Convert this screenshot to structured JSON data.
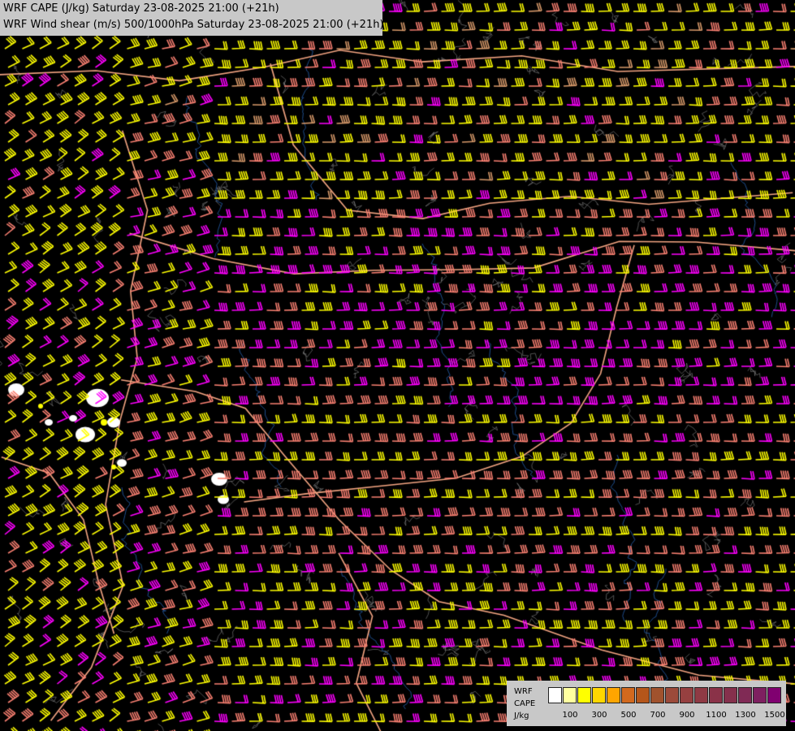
{
  "titles": {
    "line1": "WRF CAPE (J/kg) Saturday 23-08-2025 21:00 (+21h)",
    "line2": "WRF Wind shear (m/s) 500/1000hPa Saturday 23-08-2025 21:00 (+21h)"
  },
  "legend": {
    "label_line1": "WRF",
    "label_line2": "CAPE",
    "label_line3": "J/kg",
    "colors": [
      "#ffffff",
      "#ffffa0",
      "#ffff00",
      "#ffd700",
      "#ffa500",
      "#d2691e",
      "#b5561a",
      "#a0522d",
      "#9c4a3a",
      "#964040",
      "#8f3a44",
      "#8a3248",
      "#85304c",
      "#802a55",
      "#7e2060",
      "#800070"
    ],
    "ticks": [
      {
        "label": "100",
        "index": 1
      },
      {
        "label": "300",
        "index": 3
      },
      {
        "label": "500",
        "index": 5
      },
      {
        "label": "700",
        "index": 7
      },
      {
        "label": "900",
        "index": 9
      },
      {
        "label": "1100",
        "index": 11
      },
      {
        "label": "1300",
        "index": 13
      },
      {
        "label": "1500",
        "index": 15
      }
    ]
  },
  "barb_colors": {
    "low": "#ffff00",
    "mid": "#fa8072",
    "high": "#ff00ff",
    "orange": "#d89a6a"
  },
  "map_colors": {
    "background": "#000000",
    "borders": "#f4a582",
    "rivers": "#1e4d8c",
    "terrain_contour": "#888888",
    "cape_cells": "#ffffff"
  }
}
